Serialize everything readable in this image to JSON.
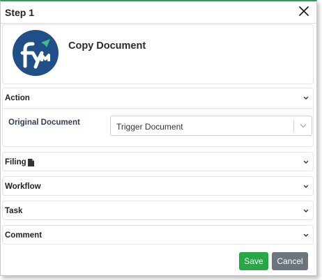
{
  "dialog": {
    "title": "Step 1",
    "close_icon": "close-icon",
    "accent_color": "#2e9e55"
  },
  "hero": {
    "logo_icon": "fym-logo",
    "name": "Copy Document"
  },
  "sections": {
    "action": {
      "label": "Action",
      "expanded": true,
      "fields": {
        "original_document": {
          "label": "Original Document",
          "value": "Trigger Document"
        }
      }
    },
    "filing": {
      "label": "Filing",
      "icon": "document-icon"
    },
    "workflow": {
      "label": "Workflow"
    },
    "task": {
      "label": "Task"
    },
    "comment": {
      "label": "Comment"
    }
  },
  "footer": {
    "save_label": "Save",
    "cancel_label": "Cancel",
    "save_color": "#28a745",
    "cancel_color": "#6c757d"
  }
}
